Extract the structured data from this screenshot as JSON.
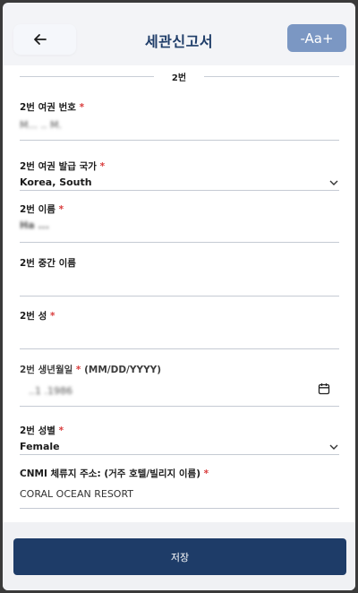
{
  "header": {
    "title": "세관신고서",
    "font_size_button": "-Aa+"
  },
  "section": {
    "title": "2번"
  },
  "fields": {
    "passport_number": {
      "label": "2번 여권 번호",
      "required": "*",
      "value": "M... .. M."
    },
    "passport_country": {
      "label": "2번 여권 발급 국가",
      "required": "*",
      "value": "Korea, South"
    },
    "first_name": {
      "label": "2번 이름",
      "required": "*",
      "value": "Ha ... "
    },
    "middle_name": {
      "label": "2번 중간 이름",
      "value": ""
    },
    "last_name": {
      "label": "2번 성",
      "required": "*",
      "value": ""
    },
    "birth_date": {
      "label": "2번 생년월일",
      "required": "*",
      "format": "(MM/DD/YYYY)",
      "value": "..1 .1986"
    },
    "gender": {
      "label": "2번 성별",
      "required": "*",
      "value": "Female"
    },
    "cnmi_address": {
      "label": "CNMI 체류지 주소: (거주 호텔/빌리지 이름)",
      "required": "*",
      "value": "CORAL OCEAN RESORT"
    }
  },
  "footer": {
    "save_label": "저장"
  },
  "colors": {
    "primary": "#1e3c68",
    "font_button": "#7b97c3",
    "required": "#d93b3b"
  }
}
